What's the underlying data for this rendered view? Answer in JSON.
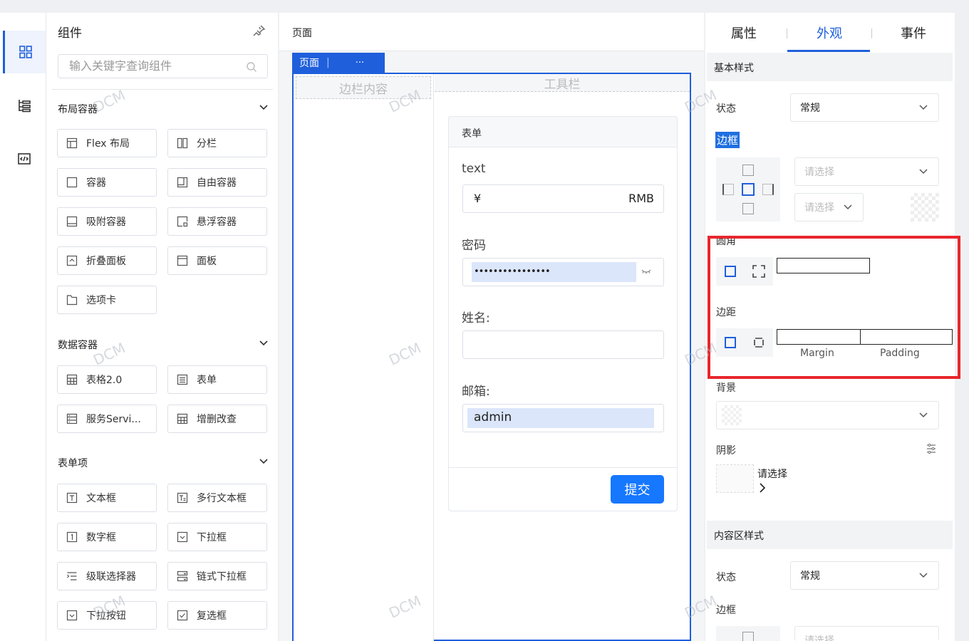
{
  "library": {
    "title": "组件",
    "search_placeholder": "输入关键字查询组件",
    "groups": [
      {
        "title": "布局容器",
        "items": [
          "Flex 布局",
          "分栏",
          "容器",
          "自由容器",
          "吸附容器",
          "悬浮容器",
          "折叠面板",
          "面板",
          "选项卡"
        ]
      },
      {
        "title": "数据容器",
        "items": [
          "表格2.0",
          "表单",
          "服务Servi...",
          "增删改查"
        ]
      },
      {
        "title": "表单项",
        "items": [
          "文本框",
          "多行文本框",
          "数字框",
          "下拉框",
          "级联选择器",
          "链式下拉框",
          "下拉按钮",
          "复选框"
        ]
      }
    ]
  },
  "canvas": {
    "breadcrumb": "页面",
    "page_tag": "页面",
    "page_tag_sep": "|",
    "page_tag_more": "···",
    "sidebar_placeholder": "边栏内容",
    "toolbar_placeholder": "工具栏",
    "form": {
      "title": "表单",
      "fields": [
        {
          "label": "text",
          "prefix": "¥",
          "suffix": "RMB",
          "value": ""
        },
        {
          "label": "密码",
          "value": "••••••••••••••••"
        },
        {
          "label": "姓名:",
          "value": ""
        },
        {
          "label": "邮箱:",
          "value": "admin"
        }
      ],
      "submit": "提交"
    }
  },
  "props": {
    "tabs": [
      "属性",
      "外观",
      "事件"
    ],
    "active_tab": "外观",
    "basic_section": "基本样式",
    "state_label": "状态",
    "state_value": "常规",
    "border_label": "边框",
    "border_select_placeholder": "请选择",
    "border_width_placeholder": "请选择",
    "radius_label": "圆角",
    "margin_label": "边距",
    "margin_caption": "Margin",
    "padding_caption": "Padding",
    "background_label": "背景",
    "shadow_label": "阴影",
    "shadow_placeholder": "请选择",
    "content_section": "内容区样式",
    "content_state_label": "状态",
    "content_state_value": "常规",
    "content_border_label": "边框",
    "content_border_placeholder": "请选择"
  },
  "watermark": "DCM",
  "colors": {
    "accent": "#1f5fdb",
    "submit": "#1677ff",
    "highlight": "#e8262c"
  }
}
